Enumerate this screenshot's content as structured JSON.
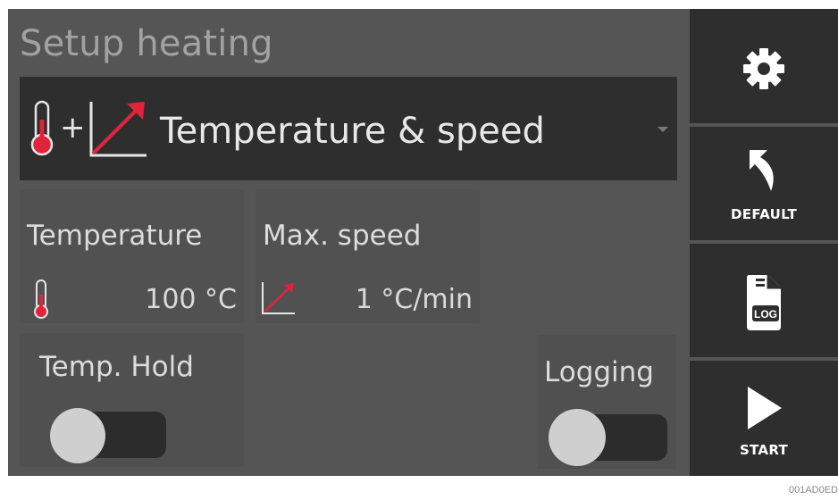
{
  "screen": {
    "title": "Setup heating"
  },
  "mode_select": {
    "plus": "+",
    "selected": "Temperature & speed",
    "accent_color": "#e0243c"
  },
  "temperature": {
    "label": "Temperature",
    "value": "100 °C",
    "icon": "thermometer-icon"
  },
  "max_speed": {
    "label": "Max. speed",
    "value": "1 °C/min",
    "icon": "rate-chart-icon"
  },
  "temp_hold": {
    "label": "Temp. Hold",
    "enabled": false
  },
  "logging": {
    "label": "Logging",
    "enabled": false
  },
  "sidebar": {
    "settings_icon": "gear-icon",
    "default_label": "DEFAULT",
    "default_icon": "back-arrow-icon",
    "log_icon": "log-file-icon",
    "log_text": "LOG",
    "start_label": "START",
    "start_icon": "play-icon"
  },
  "image_code": "001AD0ED"
}
